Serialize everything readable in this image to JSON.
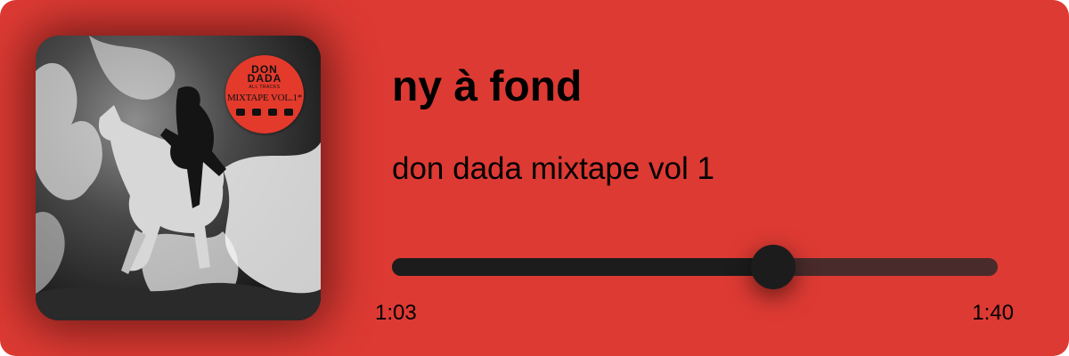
{
  "player": {
    "background_color": "#dd3a33",
    "track_color": "#4a2b2b",
    "fill_color": "#1c1c1c"
  },
  "artwork": {
    "icon": "album-cover-image",
    "sticker": {
      "brand": "DON\nDADA",
      "feat": "ALL TRACKS",
      "title": "MIXTAPE VOL.1*"
    }
  },
  "track": {
    "title": "ny à fond",
    "album": "don dada mixtape vol 1"
  },
  "playback": {
    "elapsed": "1:03",
    "total": "1:40",
    "progress": 0.63
  }
}
